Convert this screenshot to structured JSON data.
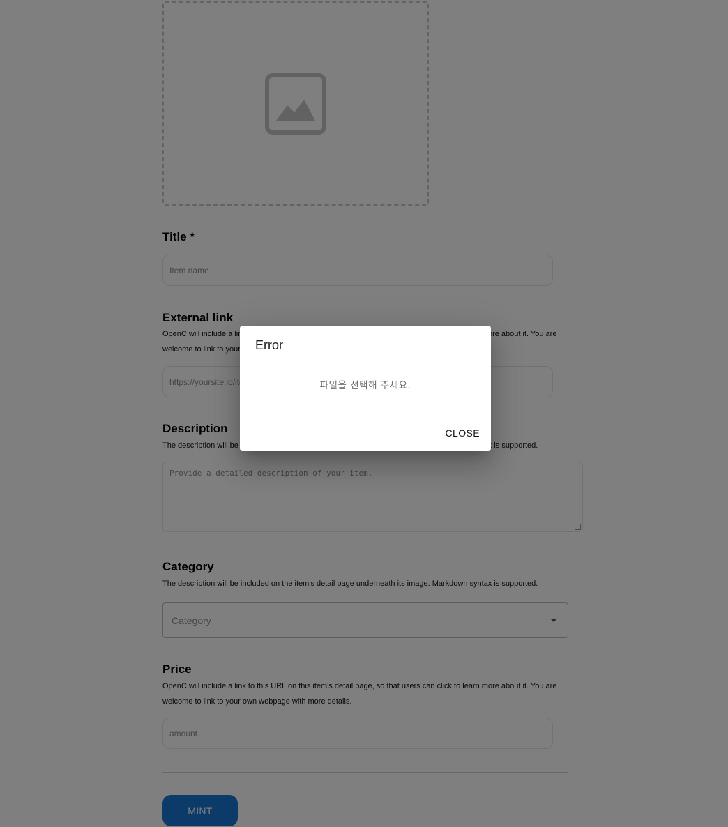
{
  "form": {
    "title_label": "Title *",
    "title_placeholder": "Item name",
    "external_link": {
      "label": "External link",
      "helper": "OpenC will include a link to this URL on this item's detail page, so that users can click to learn more about it. You are welcome to link to your own webpage with more details.",
      "placeholder": "https://yoursite.io/item/123"
    },
    "description": {
      "label": "Description",
      "helper": "The description will be included on the item's detail page underneath its image. Markdown syntax is supported.",
      "placeholder": "Provide a detailed description of your item."
    },
    "category": {
      "label": "Category",
      "helper": "The description will be included on the item's detail page underneath its image. Markdown syntax is supported.",
      "select_value": "Category"
    },
    "price": {
      "label": "Price",
      "helper": "OpenC will include a link to this URL on this item's detail page, so that users can click to learn more about it. You are welcome to link to your own webpage with more details.",
      "placeholder": "amount"
    },
    "mint_label": "MINT"
  },
  "dialog": {
    "title": "Error",
    "message": "파일을 선택해 주세요.",
    "close_label": "CLOSE"
  },
  "icons": {
    "upload": "image-placeholder-icon",
    "select_caret": "caret-down-icon"
  }
}
